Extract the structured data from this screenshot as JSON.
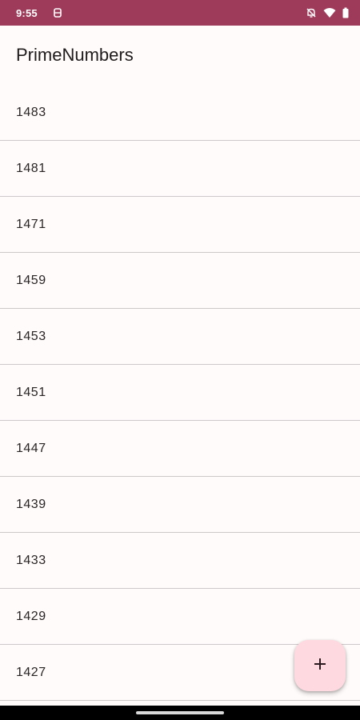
{
  "status_bar": {
    "time": "9:55",
    "icons": [
      "notification-app-icon",
      "mute-bell-icon",
      "wifi-icon",
      "battery-icon"
    ]
  },
  "app_bar": {
    "title": "PrimeNumbers"
  },
  "list": {
    "items": [
      "1483",
      "1481",
      "1471",
      "1459",
      "1453",
      "1451",
      "1447",
      "1439",
      "1433",
      "1429",
      "1427"
    ]
  },
  "fab": {
    "icon": "plus-icon"
  },
  "colors": {
    "status_bar": "#9e3a5a",
    "background": "#fffbfa",
    "fab": "#ffd9e0",
    "divider": "#cfc8ca"
  }
}
